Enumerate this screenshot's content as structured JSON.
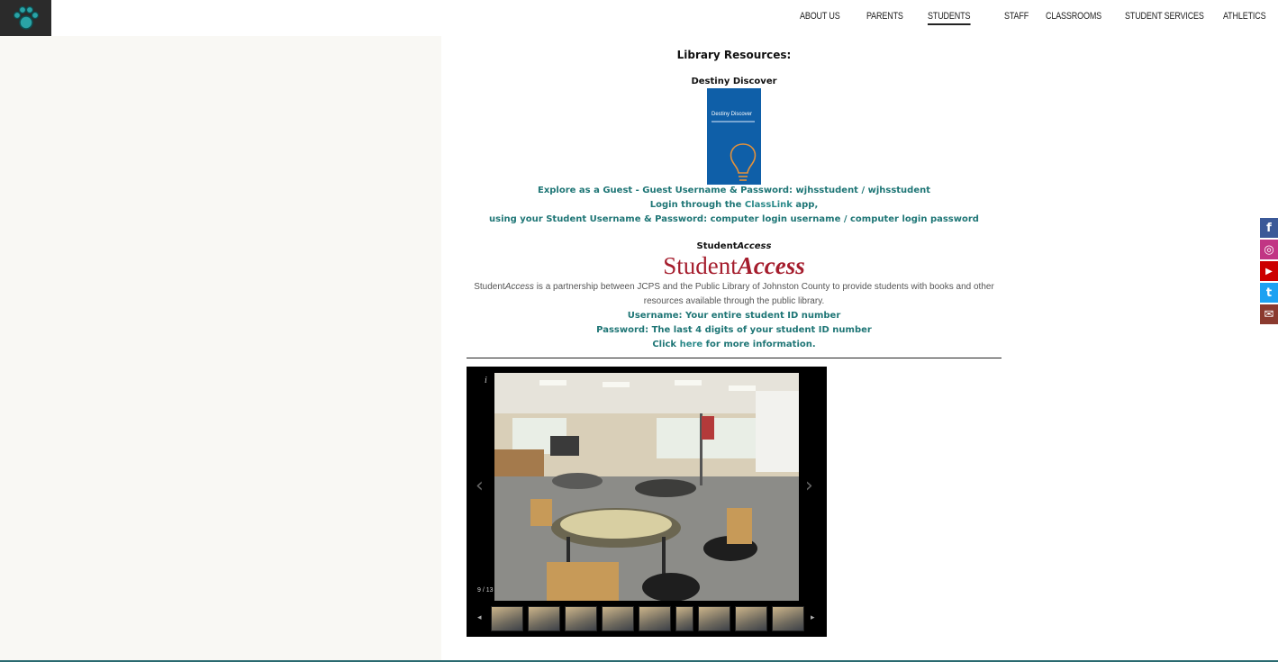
{
  "nav": {
    "items": [
      {
        "label": "ABOUT US"
      },
      {
        "label": "PARENTS"
      },
      {
        "label": "STUDENTS"
      },
      {
        "label": "STAFF"
      },
      {
        "label": "CLASSROOMS"
      },
      {
        "label": "STUDENT SERVICES"
      },
      {
        "label": "ATHLETICS"
      }
    ],
    "active": "STUDENTS"
  },
  "content": {
    "title": "Library Resources:",
    "destiny": {
      "heading": "Destiny Discover",
      "book_title": "Destiny Discover",
      "guest_line": "Explore as a Guest - Guest Username & Password: wjhsstudent / wjhsstudent",
      "login_pre": "Login through the ",
      "login_link": "ClassLink",
      "login_post": " app,",
      "credentials": "using your Student Username & Password: computer login username / computer login password"
    },
    "student_access": {
      "heading_plain": "Student",
      "heading_italic": "Access",
      "logo_plain": "Student",
      "logo_italic": "Access",
      "desc_plain": "Student",
      "desc_italic": "Access",
      "desc_rest": " is a partnership between JCPS and the Public Library of Johnston County to provide students with books and other resources available through the public library.",
      "username": "Username:  Your entire student ID number",
      "password": "Password: The last 4 digits of your student ID number",
      "click_pre": "Click ",
      "click_link": "here",
      "click_post": " for more information."
    }
  },
  "gallery": {
    "counter": "9 / 13",
    "info": "i",
    "prev": "‹",
    "next": "›",
    "thumb_prev": "◂",
    "thumb_next": "▸",
    "thumbnail_count": 9
  },
  "social": [
    {
      "name": "facebook",
      "glyph": "f",
      "color": "#3b5998"
    },
    {
      "name": "instagram",
      "glyph": "◎",
      "color": "#c13584"
    },
    {
      "name": "youtube",
      "glyph": "▶",
      "color": "#cc0000"
    },
    {
      "name": "twitter",
      "glyph": "t",
      "color": "#1da1f2"
    },
    {
      "name": "email",
      "glyph": "✉",
      "color": "#8b3a2f"
    }
  ],
  "colors": {
    "accent": "#1f7676",
    "sidebar": "#f9f8f4",
    "brand_red": "#a51d2d"
  }
}
